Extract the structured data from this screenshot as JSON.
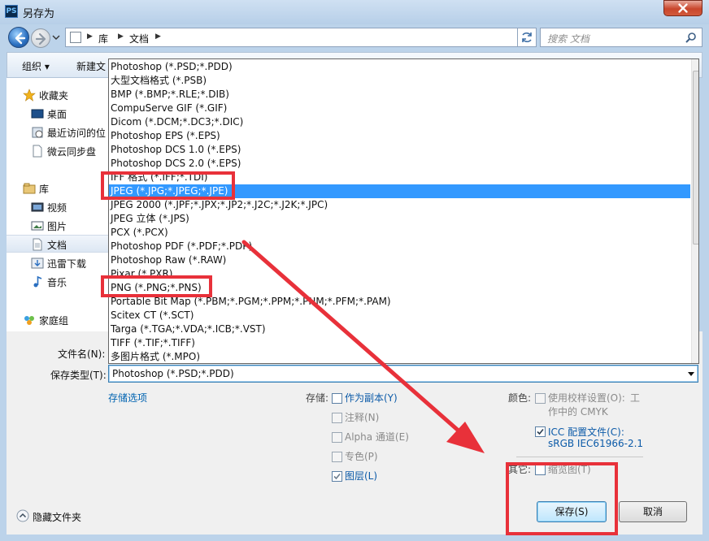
{
  "window": {
    "title": "另存为",
    "app_icon": "PS"
  },
  "address": {
    "crumbs": [
      "库",
      "文档"
    ],
    "search_placeholder": "搜索 文档"
  },
  "toolbar": {
    "organize": "组织",
    "new_folder": "新建文"
  },
  "nav": {
    "items": [
      {
        "label": "收藏夹",
        "icon": "star-icon"
      },
      {
        "label": "桌面",
        "icon": "desktop-icon"
      },
      {
        "label": "最近访问的位",
        "icon": "recent-places-icon"
      },
      {
        "label": "微云同步盘",
        "icon": "document-icon"
      },
      {
        "label": "库",
        "icon": "library-icon"
      },
      {
        "label": "视频",
        "icon": "video-icon"
      },
      {
        "label": "图片",
        "icon": "picture-icon"
      },
      {
        "label": "文档",
        "icon": "document-icon"
      },
      {
        "label": "迅雷下载",
        "icon": "download-icon"
      },
      {
        "label": "音乐",
        "icon": "music-icon"
      },
      {
        "label": "家庭组",
        "icon": "homegroup-icon"
      }
    ]
  },
  "form": {
    "filename_label": "文件名(N):",
    "type_label": "保存类型(T):",
    "type_value": "Photoshop (*.PSD;*.PDD)",
    "storage_options_link": "存储选项"
  },
  "format_list": {
    "selected_index": 9,
    "items": [
      "Photoshop (*.PSD;*.PDD)",
      "大型文档格式 (*.PSB)",
      "BMP (*.BMP;*.RLE;*.DIB)",
      "CompuServe GIF (*.GIF)",
      "Dicom (*.DCM;*.DC3;*.DIC)",
      "Photoshop EPS (*.EPS)",
      "Photoshop DCS 1.0 (*.EPS)",
      "Photoshop DCS 2.0 (*.EPS)",
      "IFF 格式 (*.IFF;*.TDI)",
      "JPEG (*.JPG;*.JPEG;*.JPE)",
      "JPEG 2000 (*.JPF;*.JPX;*.JP2;*.J2C;*.J2K;*.JPC)",
      "JPEG 立体 (*.JPS)",
      "PCX (*.PCX)",
      "Photoshop PDF (*.PDF;*.PDP)",
      "Photoshop Raw (*.RAW)",
      "Pixar (*.PXR)",
      "PNG (*.PNG;*.PNS)",
      "Portable Bit Map (*.PBM;*.PGM;*.PPM;*.PNM;*.PFM;*.PAM)",
      "Scitex CT (*.SCT)",
      "Targa (*.TGA;*.VDA;*.ICB;*.VST)",
      "TIFF (*.TIF;*.TIFF)",
      "多图片格式 (*.MPO)"
    ]
  },
  "storage": {
    "label": "存储:",
    "as_copy": "作为副本(Y)",
    "notes": "注释(N)",
    "alpha": "Alpha 通道(E)",
    "spot": "专色(P)",
    "layers": "图层(L)"
  },
  "color": {
    "label": "颜色:",
    "proof_line1": "使用校样设置(O):",
    "proof_line2": "工",
    "proof_line3": "作中的 CMYK",
    "icc": "ICC 配置文件(C):",
    "icc_profile": "sRGB IEC61966-2.1",
    "other_label": "其它:",
    "thumbnail": "缩览图(T)"
  },
  "footer": {
    "hide_folders": "隐藏文件夹",
    "save": "保存(S)",
    "cancel": "取消"
  },
  "colors": {
    "highlight": "#e8313a",
    "selection": "#3399ff",
    "link": "#0063b1"
  }
}
